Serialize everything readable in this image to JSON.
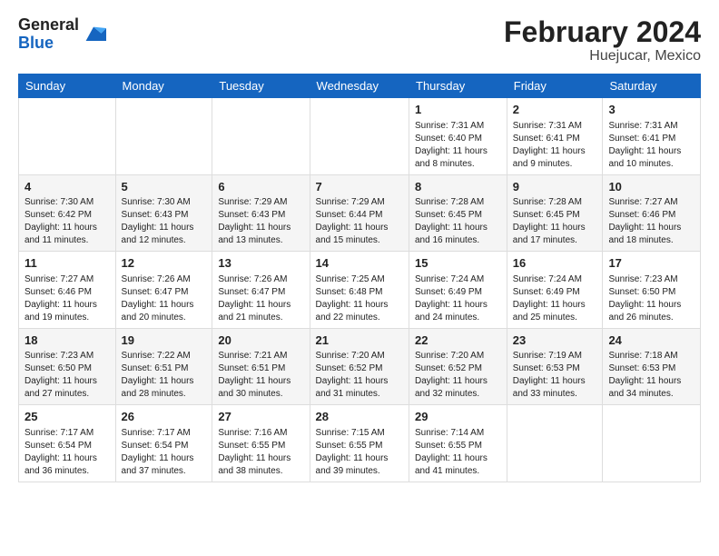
{
  "header": {
    "logo_general": "General",
    "logo_blue": "Blue",
    "month_title": "February 2024",
    "location": "Huejucar, Mexico"
  },
  "weekdays": [
    "Sunday",
    "Monday",
    "Tuesday",
    "Wednesday",
    "Thursday",
    "Friday",
    "Saturday"
  ],
  "weeks": [
    [
      {
        "day": "",
        "info": ""
      },
      {
        "day": "",
        "info": ""
      },
      {
        "day": "",
        "info": ""
      },
      {
        "day": "",
        "info": ""
      },
      {
        "day": "1",
        "info": "Sunrise: 7:31 AM\nSunset: 6:40 PM\nDaylight: 11 hours\nand 8 minutes."
      },
      {
        "day": "2",
        "info": "Sunrise: 7:31 AM\nSunset: 6:41 PM\nDaylight: 11 hours\nand 9 minutes."
      },
      {
        "day": "3",
        "info": "Sunrise: 7:31 AM\nSunset: 6:41 PM\nDaylight: 11 hours\nand 10 minutes."
      }
    ],
    [
      {
        "day": "4",
        "info": "Sunrise: 7:30 AM\nSunset: 6:42 PM\nDaylight: 11 hours\nand 11 minutes."
      },
      {
        "day": "5",
        "info": "Sunrise: 7:30 AM\nSunset: 6:43 PM\nDaylight: 11 hours\nand 12 minutes."
      },
      {
        "day": "6",
        "info": "Sunrise: 7:29 AM\nSunset: 6:43 PM\nDaylight: 11 hours\nand 13 minutes."
      },
      {
        "day": "7",
        "info": "Sunrise: 7:29 AM\nSunset: 6:44 PM\nDaylight: 11 hours\nand 15 minutes."
      },
      {
        "day": "8",
        "info": "Sunrise: 7:28 AM\nSunset: 6:45 PM\nDaylight: 11 hours\nand 16 minutes."
      },
      {
        "day": "9",
        "info": "Sunrise: 7:28 AM\nSunset: 6:45 PM\nDaylight: 11 hours\nand 17 minutes."
      },
      {
        "day": "10",
        "info": "Sunrise: 7:27 AM\nSunset: 6:46 PM\nDaylight: 11 hours\nand 18 minutes."
      }
    ],
    [
      {
        "day": "11",
        "info": "Sunrise: 7:27 AM\nSunset: 6:46 PM\nDaylight: 11 hours\nand 19 minutes."
      },
      {
        "day": "12",
        "info": "Sunrise: 7:26 AM\nSunset: 6:47 PM\nDaylight: 11 hours\nand 20 minutes."
      },
      {
        "day": "13",
        "info": "Sunrise: 7:26 AM\nSunset: 6:47 PM\nDaylight: 11 hours\nand 21 minutes."
      },
      {
        "day": "14",
        "info": "Sunrise: 7:25 AM\nSunset: 6:48 PM\nDaylight: 11 hours\nand 22 minutes."
      },
      {
        "day": "15",
        "info": "Sunrise: 7:24 AM\nSunset: 6:49 PM\nDaylight: 11 hours\nand 24 minutes."
      },
      {
        "day": "16",
        "info": "Sunrise: 7:24 AM\nSunset: 6:49 PM\nDaylight: 11 hours\nand 25 minutes."
      },
      {
        "day": "17",
        "info": "Sunrise: 7:23 AM\nSunset: 6:50 PM\nDaylight: 11 hours\nand 26 minutes."
      }
    ],
    [
      {
        "day": "18",
        "info": "Sunrise: 7:23 AM\nSunset: 6:50 PM\nDaylight: 11 hours\nand 27 minutes."
      },
      {
        "day": "19",
        "info": "Sunrise: 7:22 AM\nSunset: 6:51 PM\nDaylight: 11 hours\nand 28 minutes."
      },
      {
        "day": "20",
        "info": "Sunrise: 7:21 AM\nSunset: 6:51 PM\nDaylight: 11 hours\nand 30 minutes."
      },
      {
        "day": "21",
        "info": "Sunrise: 7:20 AM\nSunset: 6:52 PM\nDaylight: 11 hours\nand 31 minutes."
      },
      {
        "day": "22",
        "info": "Sunrise: 7:20 AM\nSunset: 6:52 PM\nDaylight: 11 hours\nand 32 minutes."
      },
      {
        "day": "23",
        "info": "Sunrise: 7:19 AM\nSunset: 6:53 PM\nDaylight: 11 hours\nand 33 minutes."
      },
      {
        "day": "24",
        "info": "Sunrise: 7:18 AM\nSunset: 6:53 PM\nDaylight: 11 hours\nand 34 minutes."
      }
    ],
    [
      {
        "day": "25",
        "info": "Sunrise: 7:17 AM\nSunset: 6:54 PM\nDaylight: 11 hours\nand 36 minutes."
      },
      {
        "day": "26",
        "info": "Sunrise: 7:17 AM\nSunset: 6:54 PM\nDaylight: 11 hours\nand 37 minutes."
      },
      {
        "day": "27",
        "info": "Sunrise: 7:16 AM\nSunset: 6:55 PM\nDaylight: 11 hours\nand 38 minutes."
      },
      {
        "day": "28",
        "info": "Sunrise: 7:15 AM\nSunset: 6:55 PM\nDaylight: 11 hours\nand 39 minutes."
      },
      {
        "day": "29",
        "info": "Sunrise: 7:14 AM\nSunset: 6:55 PM\nDaylight: 11 hours\nand 41 minutes."
      },
      {
        "day": "",
        "info": ""
      },
      {
        "day": "",
        "info": ""
      }
    ]
  ]
}
